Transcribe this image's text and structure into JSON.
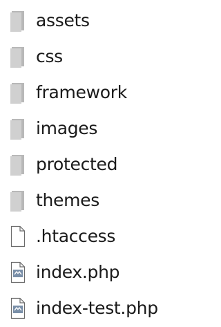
{
  "files": [
    {
      "name": "assets",
      "type": "folder",
      "icon": "folder-icon"
    },
    {
      "name": "css",
      "type": "folder",
      "icon": "folder-icon"
    },
    {
      "name": "framework",
      "type": "folder",
      "icon": "folder-icon"
    },
    {
      "name": "images",
      "type": "folder",
      "icon": "folder-icon"
    },
    {
      "name": "protected",
      "type": "folder",
      "icon": "folder-icon"
    },
    {
      "name": "themes",
      "type": "folder",
      "icon": "folder-icon"
    },
    {
      "name": ".htaccess",
      "type": "file",
      "icon": "blank-file-icon"
    },
    {
      "name": "index.php",
      "type": "php",
      "icon": "php-file-icon"
    },
    {
      "name": "index-test.php",
      "type": "php",
      "icon": "php-file-icon"
    }
  ],
  "colors": {
    "folder_front": "#d0d0d0",
    "folder_back": "#b8b8b8",
    "file_border": "#6b6b6b",
    "php_badge": "#7a8fa8",
    "text": "#1a1a1a"
  }
}
